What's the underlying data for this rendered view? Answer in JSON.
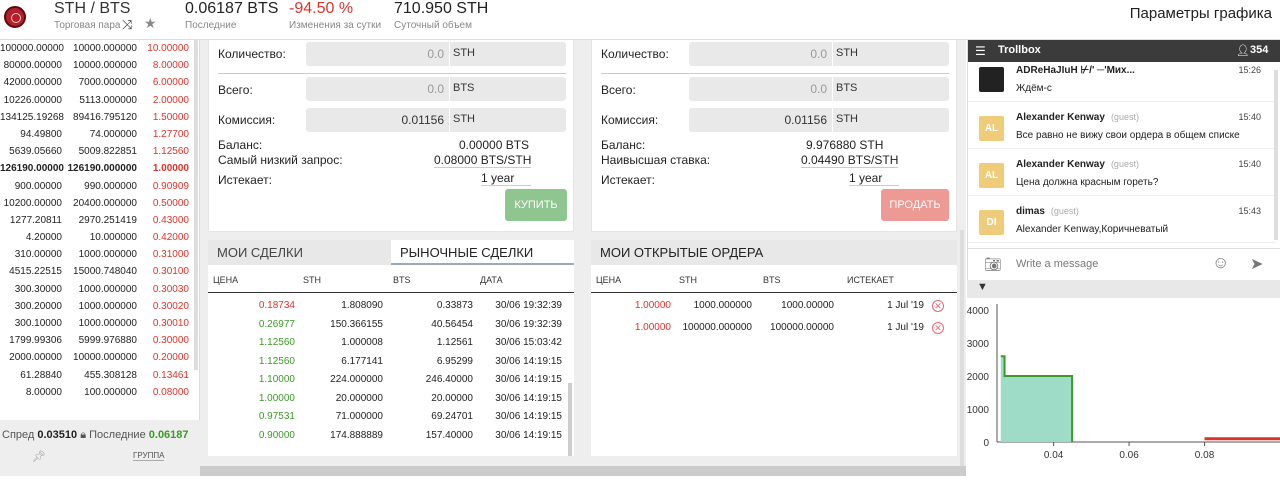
{
  "header": {
    "pair": "STH / BTS",
    "pair_sub": "Торговая пара",
    "last_price": "0.06187 BTS",
    "last_price_sub": "Последние",
    "change": "-94.50 %",
    "change_sub": "Изменения за сутки",
    "volume": "710.950 STH",
    "volume_sub": "Суточный объем",
    "chart_params": "Параметры графика",
    "icons": [
      "logo",
      "swap-icon",
      "star-icon"
    ]
  },
  "orderbook": {
    "rows": [
      {
        "total": "100000.00000",
        "amount": "10000.000000",
        "price": "10.00000",
        "color": "red"
      },
      {
        "total": "80000.00000",
        "amount": "10000.000000",
        "price": "8.00000",
        "color": "red"
      },
      {
        "total": "42000.00000",
        "amount": "7000.000000",
        "price": "6.00000",
        "color": "red"
      },
      {
        "total": "10226.00000",
        "amount": "5113.000000",
        "price": "2.00000",
        "color": "red"
      },
      {
        "total": "134125.19268",
        "amount": "89416.795120",
        "price": "1.50000",
        "color": "red"
      },
      {
        "total": "94.49800",
        "amount": "74.000000",
        "price": "1.27700",
        "color": "red"
      },
      {
        "total": "5639.05660",
        "amount": "5009.822851",
        "price": "1.12560",
        "color": "red"
      },
      {
        "total": "126190.00000",
        "amount": "126190.000000",
        "price": "1.00000",
        "color": "red",
        "bold": true
      },
      {
        "total": "900.00000",
        "amount": "990.000000",
        "price": "0.90909",
        "color": "red"
      },
      {
        "total": "10200.00000",
        "amount": "20400.000000",
        "price": "0.50000",
        "color": "red"
      },
      {
        "total": "1277.20811",
        "amount": "2970.251419",
        "price": "0.43000",
        "color": "red"
      },
      {
        "total": "4.20000",
        "amount": "10.000000",
        "price": "0.42000",
        "color": "red"
      },
      {
        "total": "310.00000",
        "amount": "1000.000000",
        "price": "0.31000",
        "color": "red"
      },
      {
        "total": "4515.22515",
        "amount": "15000.748040",
        "price": "0.30100",
        "color": "red"
      },
      {
        "total": "300.30000",
        "amount": "1000.000000",
        "price": "0.30030",
        "color": "red"
      },
      {
        "total": "300.20000",
        "amount": "1000.000000",
        "price": "0.30020",
        "color": "red"
      },
      {
        "total": "300.10000",
        "amount": "1000.000000",
        "price": "0.30010",
        "color": "red"
      },
      {
        "total": "1799.99306",
        "amount": "5999.976880",
        "price": "0.30000",
        "color": "red"
      },
      {
        "total": "2000.00000",
        "amount": "10000.000000",
        "price": "0.20000",
        "color": "red"
      },
      {
        "total": "61.28840",
        "amount": "455.308128",
        "price": "0.13461",
        "color": "red"
      },
      {
        "total": "8.00000",
        "amount": "100.000000",
        "price": "0.08000",
        "color": "red"
      }
    ],
    "spread_label": "Спред",
    "spread_value": "0.03510",
    "last_label": "Последние",
    "last_value": "0.06187",
    "group_label": "ГРУППА"
  },
  "buy_form": {
    "qty_label": "Количество:",
    "qty_value": "0.0",
    "qty_cur": "STH",
    "total_label": "Всего:",
    "total_value": "0.0",
    "total_cur": "BTS",
    "fee_label": "Комиссия:",
    "fee_value": "0.01156",
    "fee_cur": "STH",
    "balance_label": "Баланс:",
    "balance_value": "0.00000 BTS",
    "ask_label": "Самый низкий запрос:",
    "ask_value": "0.08000 BTS/STH",
    "expires_label": "Истекает:",
    "expires_value": "1 year",
    "button": "КУПИТЬ"
  },
  "sell_form": {
    "qty_label": "Количество:",
    "qty_value": "0.0",
    "qty_cur": "STH",
    "total_label": "Всего:",
    "total_value": "0.0",
    "total_cur": "BTS",
    "fee_label": "Комиссия:",
    "fee_value": "0.01156",
    "fee_cur": "STH",
    "balance_label": "Баланс:",
    "balance_value": "9.976880 STH",
    "bid_label": "Наивысшая ставка:",
    "bid_value": "0.04490 BTS/STH",
    "expires_label": "Истекает:",
    "expires_value": "1 year",
    "button": "ПРОДАТЬ"
  },
  "trades": {
    "tab_mine": "МОИ СДЕЛКИ",
    "tab_market": "РЫНОЧНЫЕ СДЕЛКИ",
    "columns": [
      "ЦЕНА",
      "STH",
      "BTS",
      "ДАТА"
    ],
    "rows": [
      {
        "price": "0.18734",
        "sth": "1.808090",
        "bts": "0.33873",
        "date": "30/06 19:32:39",
        "color": "red"
      },
      {
        "price": "0.26977",
        "sth": "150.366155",
        "bts": "40.56454",
        "date": "30/06 19:32:39",
        "color": "green"
      },
      {
        "price": "1.12560",
        "sth": "1.000008",
        "bts": "1.12561",
        "date": "30/06 15:03:42",
        "color": "green"
      },
      {
        "price": "1.12560",
        "sth": "6.177141",
        "bts": "6.95299",
        "date": "30/06 14:19:15",
        "color": "green"
      },
      {
        "price": "1.10000",
        "sth": "224.000000",
        "bts": "246.40000",
        "date": "30/06 14:19:15",
        "color": "green"
      },
      {
        "price": "1.00000",
        "sth": "20.000000",
        "bts": "20.00000",
        "date": "30/06 14:19:15",
        "color": "green"
      },
      {
        "price": "0.97531",
        "sth": "71.000000",
        "bts": "69.24701",
        "date": "30/06 14:19:15",
        "color": "green"
      },
      {
        "price": "0.90000",
        "sth": "174.888889",
        "bts": "157.40000",
        "date": "30/06 14:19:15",
        "color": "green"
      }
    ]
  },
  "open_orders": {
    "title": "МОИ ОТКРЫТЫЕ ОРДЕРА",
    "columns": [
      "ЦЕНА",
      "STH",
      "BTS",
      "ИСТЕКАЕТ"
    ],
    "rows": [
      {
        "price": "1.00000",
        "sth": "1000.000000",
        "bts": "1000.00000",
        "expires": "1 Jul '19"
      },
      {
        "price": "1.00000",
        "sth": "100000.000000",
        "bts": "100000.00000",
        "expires": "1 Jul '19"
      }
    ]
  },
  "trollbox": {
    "title": "Trollbox",
    "count": "354",
    "messages": [
      {
        "avatar": "",
        "name": "ADReHaJIuH ⊬/' ─'Мих...",
        "guest": "",
        "time": "15:26",
        "text": "Ждём-с"
      },
      {
        "avatar": "AL",
        "name": "Alexander Kenway",
        "guest": "(guest)",
        "time": "15:40",
        "text": "Все равно не вижу свои ордера в общем списке"
      },
      {
        "avatar": "AL",
        "name": "Alexander Kenway",
        "guest": "(guest)",
        "time": "15:40",
        "text": "Цена должна красным гореть?"
      },
      {
        "avatar": "DI",
        "name": "dimas",
        "guest": "(guest)",
        "time": "15:43",
        "text": "Alexander Kenway,Коричневатый"
      }
    ],
    "input_placeholder": "Write a message"
  },
  "depth_chart": {
    "colors": {
      "bid": "#9edcc8",
      "bid_line": "#3c9a28",
      "ask": "#d9342b"
    },
    "chart_data": {
      "type": "area",
      "y_ticks": [
        "4000",
        "3000",
        "2000",
        "1000",
        "0"
      ],
      "x_ticks": [
        "0.04",
        "0.06",
        "0.08"
      ],
      "ylim": [
        0,
        4000
      ],
      "xlim": [
        0.025,
        0.1
      ],
      "series": [
        {
          "side": "bid",
          "points": [
            [
              0.026,
              2600
            ],
            [
              0.027,
              2600
            ],
            [
              0.027,
              2000
            ],
            [
              0.0449,
              2000
            ],
            [
              0.0449,
              0
            ]
          ]
        },
        {
          "side": "ask",
          "points": [
            [
              0.08,
              100
            ],
            [
              0.1,
              100
            ]
          ]
        }
      ]
    }
  }
}
